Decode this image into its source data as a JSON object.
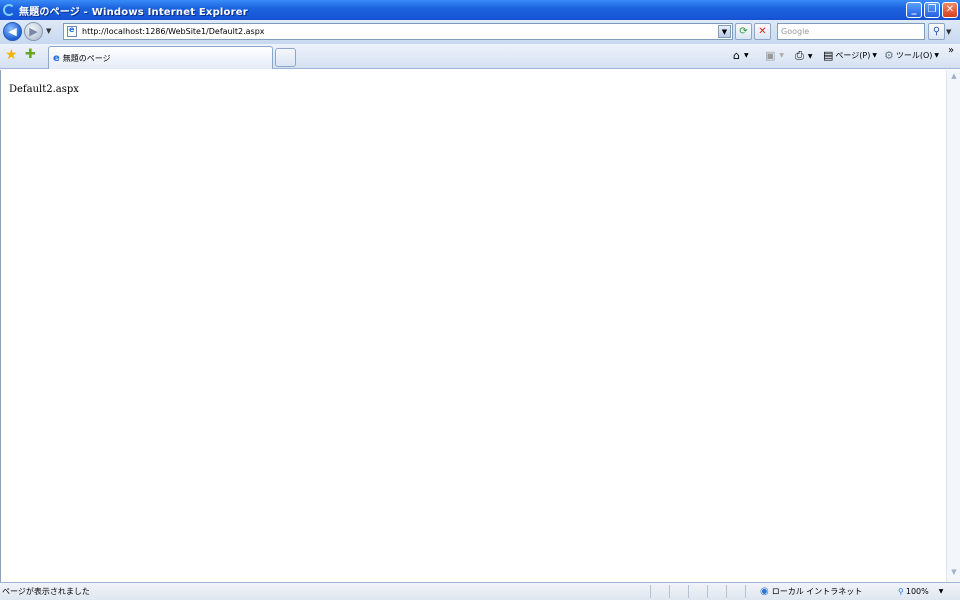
{
  "window": {
    "title": "無題のページ - Windows Internet Explorer",
    "buttons": {
      "minimize": "_",
      "maximize": "❐",
      "close": "✕"
    }
  },
  "address_bar": {
    "url": "http://localhost:1286/WebSite1/Default2.aspx",
    "search_placeholder": "Google"
  },
  "tab": {
    "label": "無題のページ"
  },
  "command_bar": {
    "page_label": "ページ(P)",
    "tools_label": "ツール(O)",
    "overflow": "»"
  },
  "content": {
    "text": "Default2.aspx"
  },
  "status_bar": {
    "text": "ページが表示されました",
    "zone": "ローカル イントラネット",
    "zoom": "100%"
  }
}
